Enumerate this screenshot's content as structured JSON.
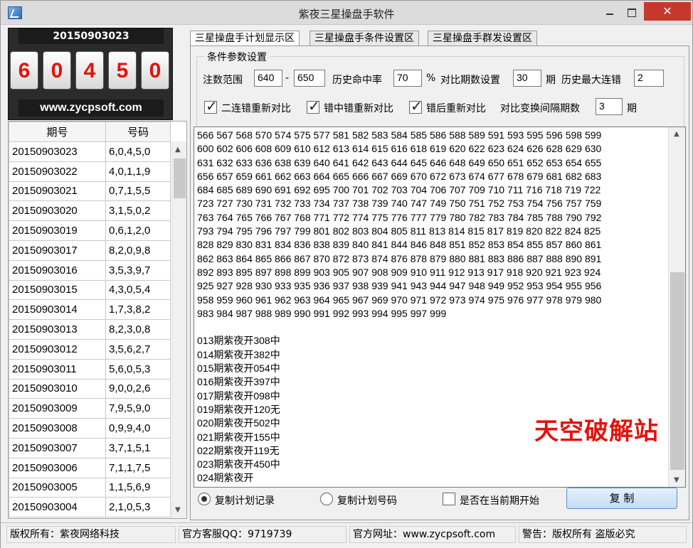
{
  "window": {
    "title": "紫夜三星操盘手软件",
    "close_glyph": "✕"
  },
  "draw": {
    "date": "20150903023",
    "digits": [
      "6",
      "0",
      "4",
      "5",
      "0"
    ],
    "site": "www.zycpsoft.com"
  },
  "history": {
    "columns": [
      "期号",
      "号码"
    ],
    "rows": [
      [
        "20150903023",
        "6,0,4,5,0"
      ],
      [
        "20150903022",
        "4,0,1,1,9"
      ],
      [
        "20150903021",
        "0,7,1,5,5"
      ],
      [
        "20150903020",
        "3,1,5,0,2"
      ],
      [
        "20150903019",
        "0,6,1,2,0"
      ],
      [
        "20150903017",
        "8,2,0,9,8"
      ],
      [
        "20150903016",
        "3,5,3,9,7"
      ],
      [
        "20150903015",
        "4,3,0,5,4"
      ],
      [
        "20150903014",
        "1,7,3,8,2"
      ],
      [
        "20150903013",
        "8,2,3,0,8"
      ],
      [
        "20150903012",
        "3,5,6,2,7"
      ],
      [
        "20150903011",
        "5,6,0,5,3"
      ],
      [
        "20150903010",
        "9,0,0,2,6"
      ],
      [
        "20150903009",
        "7,9,5,9,0"
      ],
      [
        "20150903008",
        "0,9,9,4,0"
      ],
      [
        "20150903007",
        "3,7,1,5,1"
      ],
      [
        "20150903006",
        "7,1,1,7,5"
      ],
      [
        "20150903005",
        "1,1,5,6,9"
      ],
      [
        "20150903004",
        "2,1,0,5,3"
      ]
    ]
  },
  "tabs": [
    "三星操盘手计划显示区",
    "三星操盘手条件设置区",
    "三星操盘手群发设置区"
  ],
  "conditions": {
    "legend": "条件参数设置",
    "range_label": "注数范围",
    "range_min": "640",
    "range_sep": "-",
    "range_max": "650",
    "hit_rate_label": "历史命中率",
    "hit_rate": "70",
    "percent": "%",
    "periods_label": "对比期数设置",
    "periods": "30",
    "periods_unit": "期",
    "max_streak_label": "历史最大连错",
    "max_streak": "2",
    "cb1": "二连错重新对比",
    "cb2": "错中错重新对比",
    "cb3": "错后重新对比",
    "interval_label": "对比变换间隔期数",
    "interval": "3",
    "interval_unit": "期"
  },
  "output": {
    "text": "566 567 568 570 574 575 577 581 582 583 584 585 586 588 589 591 593 595 596 598 599\n600 602 606 608 609 610 612 613 614 615 616 618 619 620 622 623 624 626 628 629 630\n631 632 633 636 638 639 640 641 642 643 644 645 646 648 649 650 651 652 653 654 655\n656 657 659 661 662 663 664 665 666 667 669 670 672 673 674 677 678 679 681 682 683\n684 685 689 690 691 692 695 700 701 702 703 704 706 707 709 710 711 716 718 719 722\n723 727 730 731 732 733 734 737 738 739 740 747 749 750 751 752 753 754 756 757 759\n763 764 765 766 767 768 771 772 774 775 776 777 779 780 782 783 784 785 788 790 792\n793 794 795 796 797 799 801 802 803 804 805 811 813 814 815 817 819 820 822 824 825\n828 829 830 831 834 836 838 839 840 841 844 846 848 851 852 853 854 855 857 860 861\n862 863 864 865 866 867 870 872 873 874 876 878 879 880 881 883 886 887 888 890 891\n892 893 895 897 898 899 903 905 907 908 909 910 911 912 913 917 918 920 921 923 924\n925 927 928 930 933 935 936 937 938 939 941 943 944 947 948 949 952 953 954 955 956\n958 959 960 961 962 963 964 965 967 969 970 971 972 973 974 975 976 977 978 979 980\n983 984 987 988 989 990 991 992 993 994 995 997 999\n\n013期紫夜开308中\n014期紫夜开382中\n015期紫夜开054中\n016期紫夜开397中\n017期紫夜开098中\n019期紫夜开120无\n020期紫夜开502中\n021期紫夜开155中\n022期紫夜开119无\n023期紫夜开450中\n024期紫夜开",
    "watermark": "天空破解站"
  },
  "bottom": {
    "radio1": "复制计划记录",
    "radio2": "复制计划号码",
    "checkbox": "是否在当前期开始",
    "copy_button": "复 制"
  },
  "status": {
    "s1": "版权所有：紫夜网络科技",
    "s2": "官方客服QQ：9719739",
    "s3": "官方网址：www.zycpsoft.com",
    "s4": "警告：版权所有 盗版必究"
  }
}
